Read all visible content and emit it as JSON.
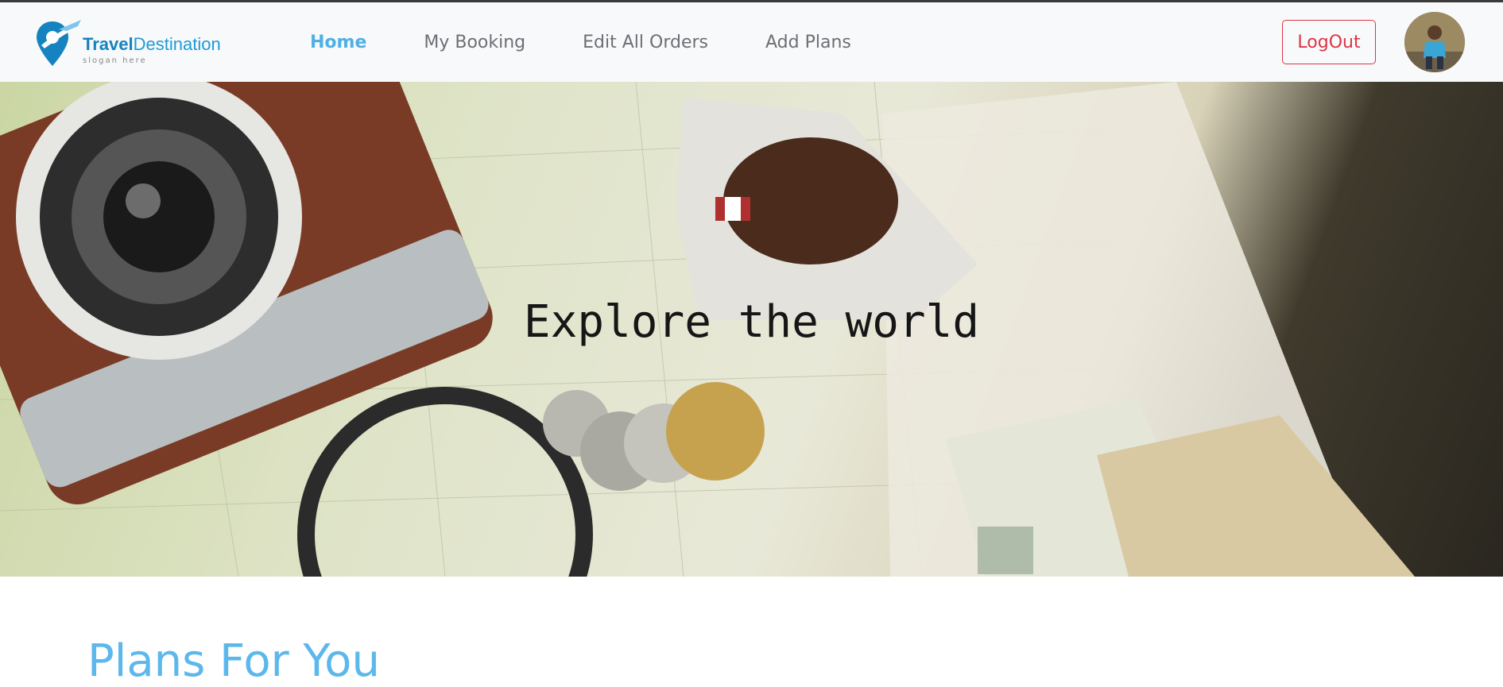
{
  "brand": {
    "name_bold": "Travel",
    "name_rest": "Destination",
    "slogan": "slogan here",
    "icon": "location-plane-logo-icon",
    "color": "#1e9ad6"
  },
  "nav": {
    "items": [
      {
        "label": "Home",
        "active": true
      },
      {
        "label": "My Booking",
        "active": false
      },
      {
        "label": "Edit All Orders",
        "active": false
      },
      {
        "label": "Add Plans",
        "active": false
      }
    ],
    "active_color": "#4fb0e4"
  },
  "auth": {
    "logout_label": "LogOut",
    "logout_color": "#dc3545",
    "avatar_icon": "user-avatar"
  },
  "hero": {
    "title": "Explore the world",
    "image_description_icon": "travel-map-camera-image"
  },
  "section": {
    "title": "Plans For You",
    "title_color": "#5cb8ec"
  }
}
